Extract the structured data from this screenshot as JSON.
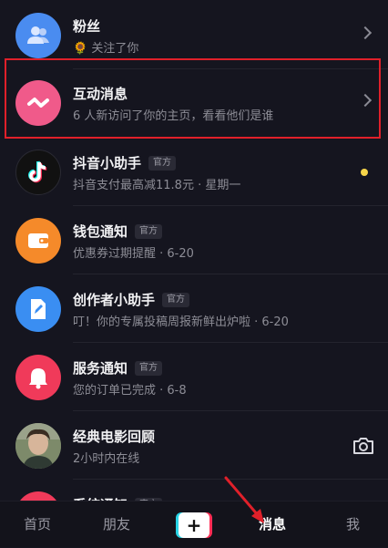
{
  "messages": [
    {
      "title": "粉丝",
      "subtitle_emoji": "🌻",
      "subtitle": "关注了你",
      "icon": "users-icon",
      "avatar_color": "#4a8cf0",
      "trailing": "chevron"
    },
    {
      "title": "互动消息",
      "subtitle": "6 人新访问了你的主页，看看他们是谁",
      "icon": "wave-icon",
      "avatar_color": "#f05a8a",
      "trailing": "chevron"
    },
    {
      "title": "抖音小助手",
      "tag": "官方",
      "subtitle": "抖音支付最高减11.8元 · 星期一",
      "icon": "douyin-logo-icon",
      "avatar_color": "#111111",
      "trailing": "unread-dot"
    },
    {
      "title": "钱包通知",
      "tag": "官方",
      "subtitle": "优惠券过期提醒 · 6-20",
      "icon": "wallet-icon",
      "avatar_color": "#f58a2a",
      "trailing": "none"
    },
    {
      "title": "创作者小助手",
      "tag": "官方",
      "subtitle": "叮！你的专属投稿周报新鲜出炉啦 · 6-20",
      "icon": "edit-icon",
      "avatar_color": "#3a8ef2",
      "trailing": "none"
    },
    {
      "title": "服务通知",
      "tag": "官方",
      "subtitle": "您的订单已完成 · 6-8",
      "icon": "bell-icon",
      "avatar_color": "#f03a5a",
      "trailing": "none"
    },
    {
      "title": "经典电影回顾",
      "subtitle": "2小时内在线",
      "icon": "person-photo",
      "avatar_color": "#5a6a5a",
      "trailing": "camera"
    },
    {
      "title": "系统通知",
      "tag": "官方",
      "subtitle": "",
      "icon": "system-icon",
      "avatar_color": "#f03a5a",
      "trailing": "none"
    }
  ],
  "nav": {
    "home": "首页",
    "friends": "朋友",
    "create": "+",
    "messages": "消息",
    "me": "我"
  },
  "colors": {
    "background": "#15151f",
    "highlight": "#e0202a",
    "unread_dot": "#f7d54a"
  }
}
